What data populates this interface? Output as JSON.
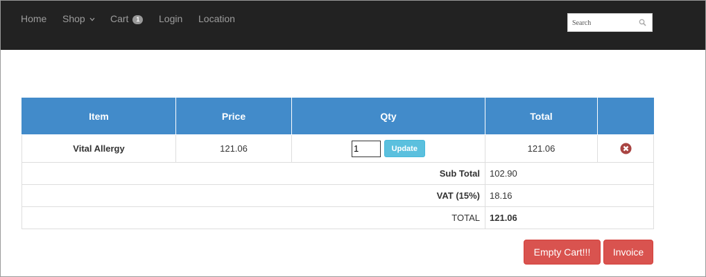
{
  "nav": {
    "home": "Home",
    "shop": "Shop",
    "cart": "Cart",
    "cart_count": "1",
    "login": "Login",
    "location": "Location"
  },
  "search": {
    "placeholder": "Search"
  },
  "table": {
    "headers": [
      "Item",
      "Price",
      "Qty",
      "Total",
      ""
    ],
    "rows": [
      {
        "item": "Vital Allergy",
        "price": "121.06",
        "qty": "1",
        "update_label": "Update",
        "total": "121.06"
      }
    ]
  },
  "summary": {
    "subtotal_label": "Sub Total",
    "subtotal_value": "102.90",
    "vat_label": "VAT (15%)",
    "vat_value": "18.16",
    "total_label": "TOTAL",
    "total_value": "121.06"
  },
  "actions": {
    "empty_cart": "Empty Cart!!!",
    "invoice": "Invoice"
  },
  "colors": {
    "navbar": "#222222",
    "header": "#428bca",
    "danger": "#d9534f",
    "info": "#5bc0de"
  },
  "icons": {
    "search": "search-icon",
    "remove": "remove-circle-icon",
    "caret": "chevron-down-icon"
  }
}
